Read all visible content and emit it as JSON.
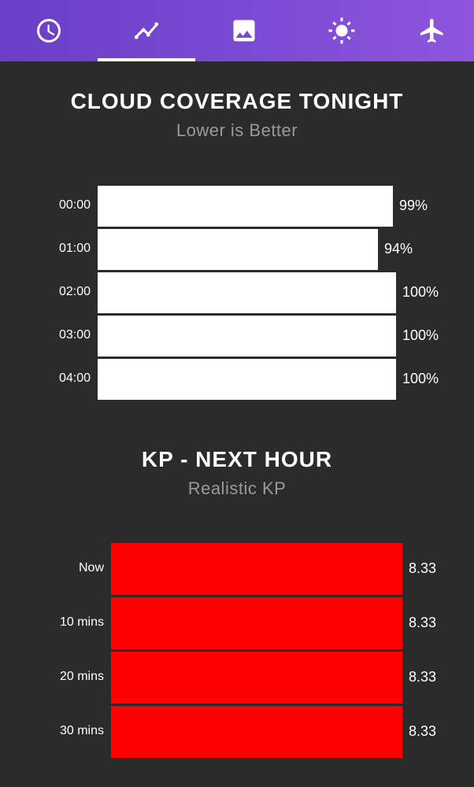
{
  "tabs": [
    {
      "icon": "clock-icon",
      "active": false
    },
    {
      "icon": "trend-icon",
      "active": true
    },
    {
      "icon": "image-icon",
      "active": false
    },
    {
      "icon": "sun-icon",
      "active": false
    },
    {
      "icon": "airplane-icon",
      "active": false
    }
  ],
  "cloud": {
    "title": "CLOUD COVERAGE TONIGHT",
    "subtitle": "Lower is Better",
    "chart_data": {
      "type": "bar",
      "orientation": "horizontal",
      "categories": [
        "00:00",
        "01:00",
        "02:00",
        "03:00",
        "04:00"
      ],
      "values": [
        99,
        94,
        100,
        100,
        100
      ],
      "value_labels": [
        "99%",
        "94%",
        "100%",
        "100%",
        "100%"
      ],
      "xlim": [
        0,
        100
      ],
      "bar_color": "#ffffff"
    }
  },
  "kp": {
    "title": "KP - NEXT HOUR",
    "subtitle": "Realistic KP",
    "chart_data": {
      "type": "bar",
      "orientation": "horizontal",
      "categories": [
        "Now",
        "10 mins",
        "20 mins",
        "30 mins"
      ],
      "values": [
        8.33,
        8.33,
        8.33,
        8.33
      ],
      "value_labels": [
        "8.33",
        "8.33",
        "8.33",
        "8.33"
      ],
      "bar_color": "#ff0000"
    }
  }
}
